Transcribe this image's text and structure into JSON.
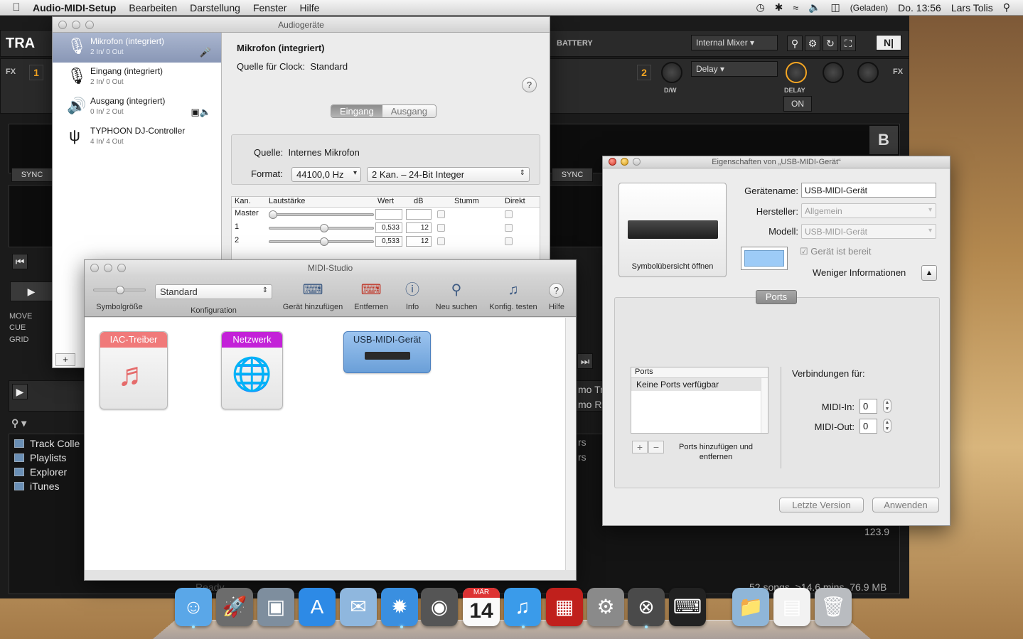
{
  "menubar": {
    "app_name": "Audio-MIDI-Setup",
    "menus": [
      "Bearbeiten",
      "Darstellung",
      "Fenster",
      "Hilfe"
    ],
    "battery_status": "(Geladen)",
    "clock": "Do. 13:56",
    "user": "Lars Tolis",
    "icons": [
      "apple-icon",
      "time-machine-icon",
      "bluetooth-icon",
      "wifi-icon",
      "volume-icon",
      "battery-icon",
      "spotlight-icon"
    ]
  },
  "traktor": {
    "logo": "TRA",
    "battery_label": "BATTERY",
    "mixer_mode": "Internal Mixer",
    "fx_label": "FX",
    "fx_unit_1": "1",
    "fx_unit_2": "2",
    "fx_effect": "Delay",
    "dw_label": "D/W",
    "delay_label": "DELAY",
    "on_label": "ON",
    "deck_b": "B",
    "sync_left": "SYNC",
    "sync_right": "SYNC",
    "side_labels": [
      "MOVE",
      "CUE",
      "GRID"
    ],
    "browser_items": [
      "Track Colle",
      "Playlists",
      "Explorer",
      "iTunes"
    ],
    "partial_right_1": "mo Tr",
    "partial_right_2": "mo Re",
    "partial_rs_1": "rs",
    "partial_rs_2": "rs",
    "bpm": "123.9",
    "status_ready": "Ready",
    "status_songs": "52 songs, >14.6 mins, 76.9 MB"
  },
  "audio_window": {
    "title": "Audiogeräte",
    "devices": [
      {
        "name": "Mikrofon (integriert)",
        "io": "2 In/ 0 Out"
      },
      {
        "name": "Eingang (integriert)",
        "io": "2 In/ 0 Out"
      },
      {
        "name": "Ausgang (integriert)",
        "io": "0 In/ 2 Out"
      },
      {
        "name": "TYPHOON DJ-Controller",
        "io": "4 In/ 4 Out"
      }
    ],
    "add_button": "+",
    "detail_title": "Mikrofon (integriert)",
    "clock_label": "Quelle für Clock:",
    "clock_value": "Standard",
    "help": "?",
    "tab_input": "Eingang",
    "tab_output": "Ausgang",
    "source_label": "Quelle:",
    "source_value": "Internes Mikrofon",
    "format_label": "Format:",
    "format_rate": "44100,0 Hz",
    "format_bits": "2 Kan. – 24-Bit Integer",
    "table_headers": {
      "channel": "Kan.",
      "volume": "Lautstärke",
      "value": "Wert",
      "db": "dB",
      "mute": "Stumm",
      "direct": "Direkt"
    },
    "channels": [
      {
        "name": "Master",
        "value": "",
        "db": "",
        "level": 0
      },
      {
        "name": "1",
        "value": "0,533",
        "db": "12",
        "level": 0.533
      },
      {
        "name": "2",
        "value": "0,533",
        "db": "12",
        "level": 0.533
      }
    ]
  },
  "midi_window": {
    "title": "MIDI-Studio",
    "toolbar": {
      "icon_size": "Symbolgröße",
      "config_value": "Standard",
      "config_label": "Konfiguration",
      "add_device": "Gerät hinzufügen",
      "remove": "Entfernen",
      "info": "Info",
      "rescan": "Neu suchen",
      "test": "Konfig. testen",
      "help": "Hilfe"
    },
    "devices": [
      {
        "name": "IAC-Treiber",
        "color": "#f07a7a"
      },
      {
        "name": "Netzwerk",
        "color": "#c322d8"
      },
      {
        "name": "USB-MIDI-Gerät",
        "color": "#6a9fd8"
      }
    ]
  },
  "props_window": {
    "title": "Eigenschaften von „USB-MIDI-Gerät“",
    "open_icons": "Symbolübersicht öffnen",
    "name_label": "Gerätename:",
    "name_value": "USB-MIDI-Gerät",
    "maker_label": "Hersteller:",
    "maker_value": "Allgemein",
    "model_label": "Modell:",
    "model_value": "USB-MIDI-Gerät",
    "ready_label": "Gerät ist bereit",
    "less_info": "Weniger Informationen",
    "ports_tab": "Ports",
    "ports_header": "Ports",
    "ports_empty": "Keine Ports verfügbar",
    "ports_hint": "Ports hinzufügen und entfernen",
    "connections_label": "Verbindungen für:",
    "midi_in_label": "MIDI-In:",
    "midi_in_value": "0",
    "midi_out_label": "MIDI-Out:",
    "midi_out_value": "0",
    "revert_button": "Letzte Version",
    "apply_button": "Anwenden",
    "well_color": "#9dcbf7"
  },
  "dock": {
    "apps": [
      "finder-icon",
      "launchpad-icon",
      "preview-icon",
      "app-store-icon",
      "mail-icon",
      "safari-icon",
      "facetime-icon",
      "calendar-icon",
      "itunes-icon",
      "photo-booth-icon",
      "system-preferences-icon",
      "traktor-icon",
      "piano-icon",
      "downloads-folder-icon",
      "document-stack-icon",
      "trash-icon"
    ],
    "calendar_month": "MÄR",
    "calendar_day": "14"
  }
}
